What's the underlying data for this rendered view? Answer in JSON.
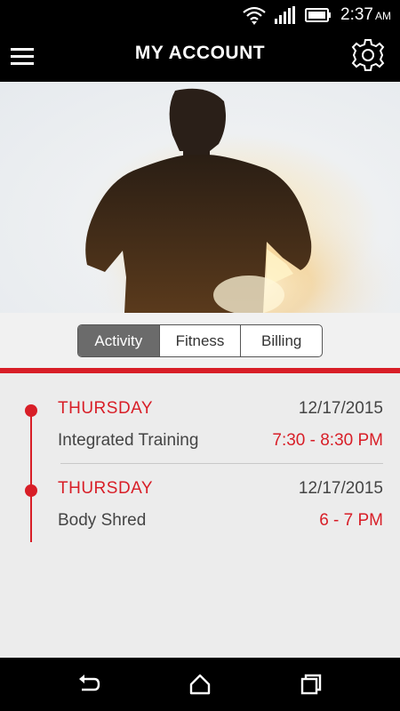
{
  "status_bar": {
    "time": "2:37",
    "ampm": "AM",
    "icons": [
      "wifi-icon",
      "signal-icon",
      "battery-icon"
    ]
  },
  "app_bar": {
    "title": "MY ACCOUNT",
    "menu_icon": "hamburger-menu-icon",
    "settings_icon": "gear-icon"
  },
  "tabs": [
    {
      "label": "Activity",
      "active": true
    },
    {
      "label": "Fitness",
      "active": false
    },
    {
      "label": "Billing",
      "active": false
    }
  ],
  "activities": [
    {
      "day": "THURSDAY",
      "date": "12/17/2015",
      "name": "Integrated Training",
      "time": "7:30 - 8:30 PM"
    },
    {
      "day": "THURSDAY",
      "date": "12/17/2015",
      "name": "Body Shred",
      "time": "6 - 7 PM"
    }
  ],
  "nav_bar": {
    "icons": [
      "back-icon",
      "home-icon",
      "recent-apps-icon"
    ]
  },
  "colors": {
    "accent": "#d81e27",
    "header": "#000000",
    "active_tab": "#6b6b6b"
  }
}
